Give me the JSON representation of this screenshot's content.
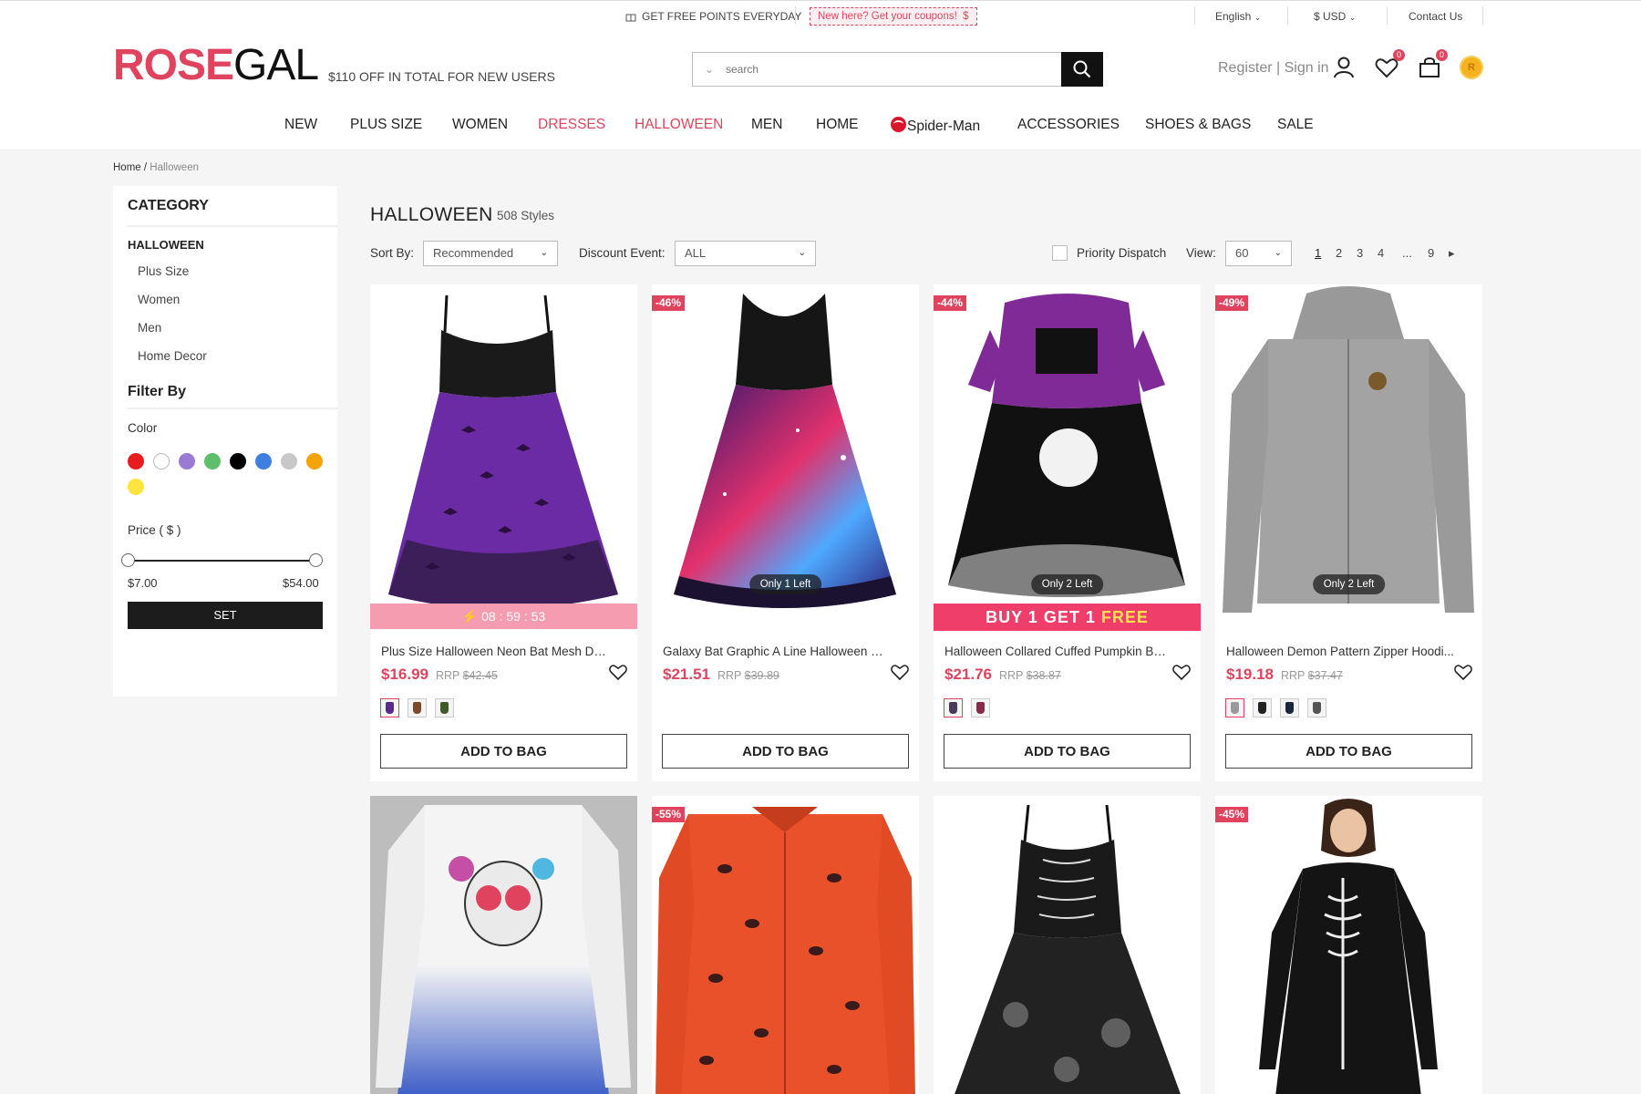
{
  "topbar": {
    "promo": "GET FREE POINTS EVERYDAY",
    "coupon": "New here? Get your coupons!",
    "coupon_icon": "$",
    "language": "English",
    "currency": "$ USD",
    "contact": "Contact Us"
  },
  "header": {
    "logo_rose": "ROSE",
    "logo_gal": "GAL",
    "tagline": "$110 OFF IN TOTAL FOR NEW USERS",
    "search_placeholder": "search",
    "account": "Register | Sign in",
    "wishlist_count": "0",
    "bag_count": "0",
    "points_icon": "R"
  },
  "nav": [
    {
      "label": "NEW"
    },
    {
      "label": "PLUS SIZE"
    },
    {
      "label": "WOMEN"
    },
    {
      "label": "DRESSES"
    },
    {
      "label": "HALLOWEEN"
    },
    {
      "label": "MEN"
    },
    {
      "label": "HOME"
    },
    {
      "label": "Spider-Man"
    },
    {
      "label": "ACCESSORIES"
    },
    {
      "label": "SHOES & BAGS"
    },
    {
      "label": "SALE"
    }
  ],
  "breadcrumb": {
    "home": "Home",
    "sep": " / ",
    "current": "Halloween"
  },
  "sidebar": {
    "category_title": "CATEGORY",
    "category": "HALLOWEEN",
    "subcategories": [
      "Plus Size",
      "Women",
      "Men",
      "Home Decor"
    ],
    "filter_title": "Filter By",
    "color_label": "Color",
    "colors": [
      "#e81c1c",
      "#ffffff",
      "#9b7ad6",
      "#5dbf6b",
      "#000000",
      "#3f7fe0",
      "#c8c8c8",
      "#f5a30a",
      "#ffe340"
    ],
    "price_label": "Price ( $ )",
    "price_min": "$7.00",
    "price_max": "$54.00",
    "set_button": "SET"
  },
  "main": {
    "title": "HALLOWEEN",
    "count": "508 Styles",
    "sort_label": "Sort By:",
    "sort_value": "Recommended",
    "discount_label": "Discount Event:",
    "discount_value": "ALL",
    "priority": "Priority Dispatch",
    "view_label": "View:",
    "view_value": "60",
    "pages": [
      "1",
      "2",
      "3",
      "4",
      "...",
      "9"
    ],
    "next_icon": "▸"
  },
  "products": [
    {
      "name": "Plus Size Halloween Neon Bat Mesh Dre...",
      "price": "$16.99",
      "rrp_label": "RRP",
      "rrp": "$42.45",
      "flash_timer": "08 : 59 : 53",
      "add_label": "ADD TO BAG"
    },
    {
      "name": "Galaxy Bat Graphic A Line Halloween Dr...",
      "price": "$21.51",
      "rrp_label": "RRP",
      "rrp": "$39.89",
      "discount": "-46%",
      "stock": "Only 1 Left",
      "add_label": "ADD TO BAG"
    },
    {
      "name": "Halloween Collared Cuffed Pumpkin Bat ...",
      "price": "$21.76",
      "rrp_label": "RRP",
      "rrp": "$38.87",
      "discount": "-44%",
      "stock": "Only 2 Left",
      "bogo_a": "BUY 1 GET 1 ",
      "bogo_b": "FREE",
      "add_label": "ADD TO BAG"
    },
    {
      "name": "Halloween Demon Pattern Zipper Hoodi...",
      "price": "$19.18",
      "rrp_label": "RRP",
      "rrp": "$37.47",
      "discount": "-49%",
      "stock": "Only 2 Left",
      "add_label": "ADD TO BAG"
    },
    {
      "name": "",
      "discount": ""
    },
    {
      "name": "",
      "discount": "-55%"
    },
    {
      "name": "",
      "discount": ""
    },
    {
      "name": "",
      "discount": "-45%"
    }
  ]
}
